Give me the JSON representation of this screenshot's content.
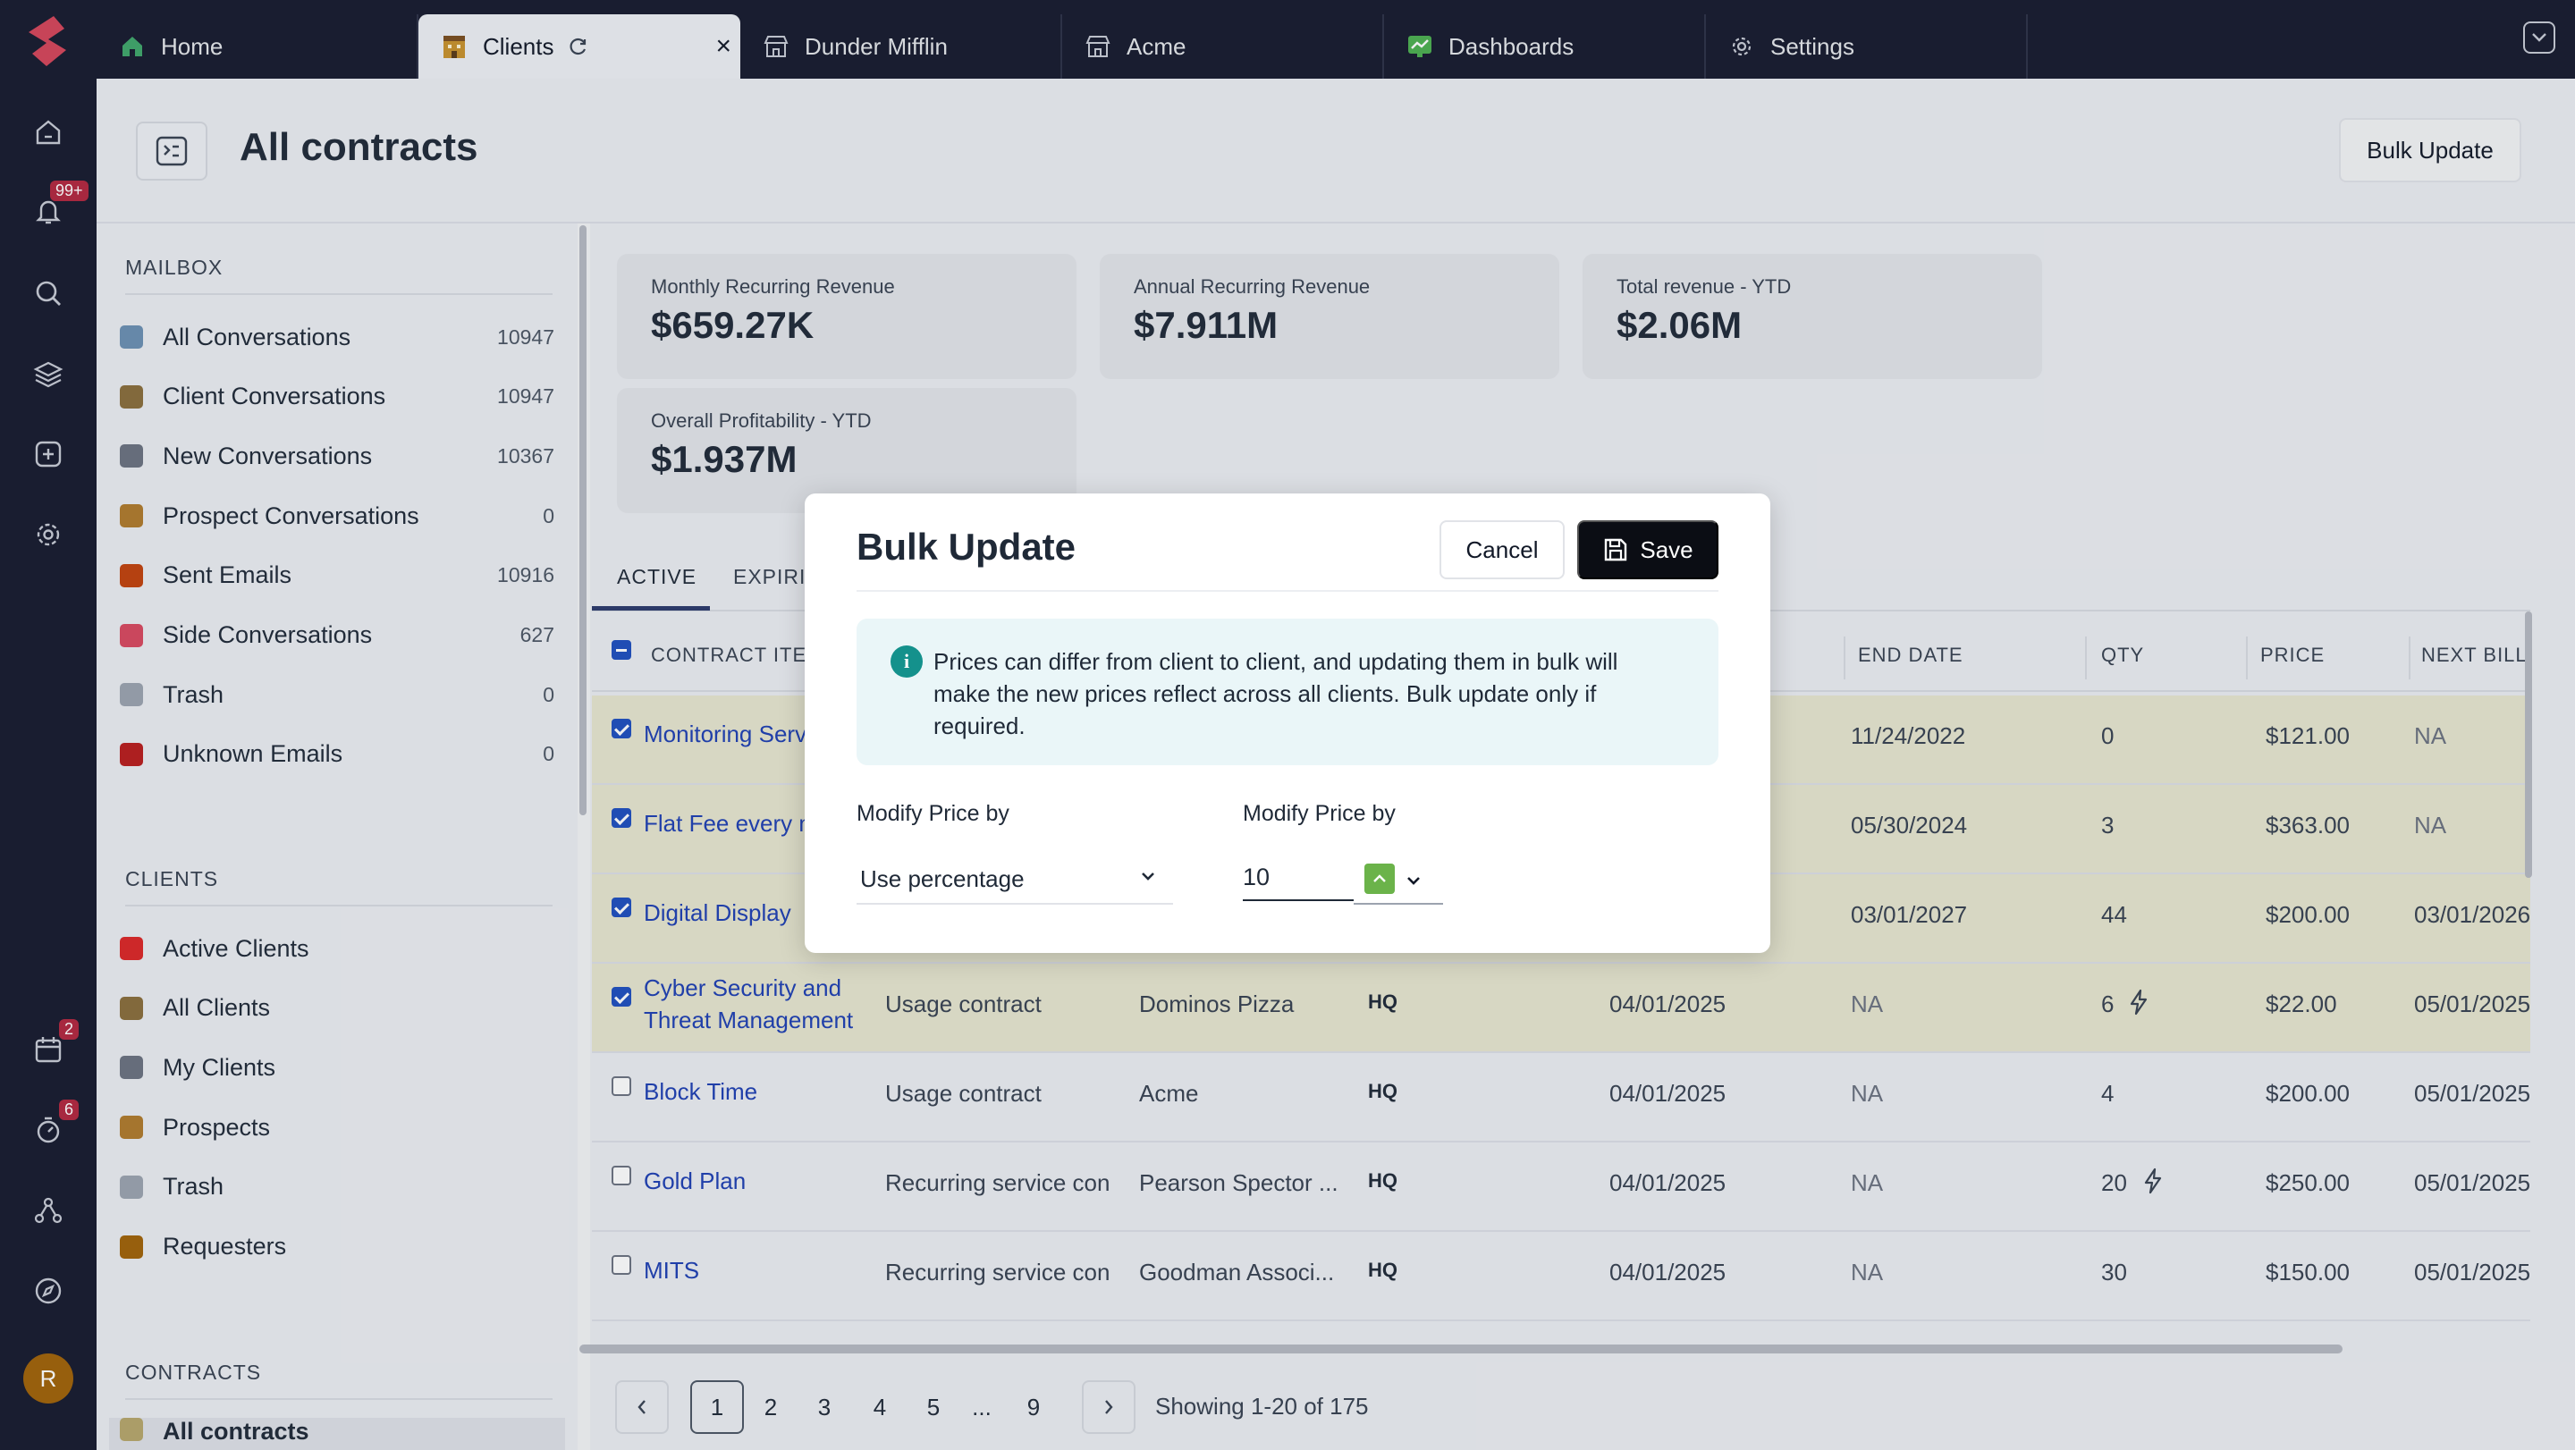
{
  "tabs": [
    {
      "label": "Home"
    },
    {
      "label": "Clients"
    },
    {
      "label": "Dunder Mifflin"
    },
    {
      "label": "Acme"
    },
    {
      "label": "Dashboards"
    },
    {
      "label": "Settings"
    }
  ],
  "rail": {
    "notifications_badge": "99+",
    "calendar_badge": "2",
    "timer_badge": "6",
    "avatar_initial": "R"
  },
  "page": {
    "title": "All contracts",
    "bulk_update_label": "Bulk Update"
  },
  "sidebar": {
    "mailbox_title": "MAILBOX",
    "mailbox": [
      {
        "label": "All Conversations",
        "count": "10947",
        "color": "#6b8fb3"
      },
      {
        "label": "Client Conversations",
        "count": "10947",
        "color": "#8a6d3b"
      },
      {
        "label": "New Conversations",
        "count": "10367",
        "color": "#6b7280"
      },
      {
        "label": "Prospect Conversations",
        "count": "0",
        "color": "#b07a2b"
      },
      {
        "label": "Sent Emails",
        "count": "10916",
        "color": "#c2410c"
      },
      {
        "label": "Side Conversations",
        "count": "627",
        "color": "#d9485f"
      },
      {
        "label": "Trash",
        "count": "0",
        "color": "#9ca3af"
      },
      {
        "label": "Unknown Emails",
        "count": "0",
        "color": "#b91c1c"
      }
    ],
    "clients_title": "CLIENTS",
    "clients": [
      {
        "label": "Active Clients",
        "color": "#dc2626"
      },
      {
        "label": "All Clients",
        "color": "#8a6d3b"
      },
      {
        "label": "My Clients",
        "color": "#6b7280"
      },
      {
        "label": "Prospects",
        "color": "#b07a2b"
      },
      {
        "label": "Trash",
        "color": "#9ca3af"
      },
      {
        "label": "Requesters",
        "color": "#a16207"
      }
    ],
    "contracts_title": "CONTRACTS",
    "contracts_selected": "All contracts"
  },
  "cards": [
    {
      "label": "Monthly Recurring Revenue",
      "value": "$659.27K"
    },
    {
      "label": "Annual Recurring Revenue",
      "value": "$7.911M"
    },
    {
      "label": "Total revenue - YTD",
      "value": "$2.06M"
    },
    {
      "label": "Overall Profitability - YTD",
      "value": "$1.937M"
    }
  ],
  "subtabs": {
    "active": "ACTIVE",
    "second": "EXPIRIN"
  },
  "table": {
    "headers": {
      "item": "CONTRACT ITEM",
      "end_date": "END DATE",
      "qty": "QTY",
      "price": "PRICE",
      "next_bill": "NEXT BILL"
    },
    "rows": [
      {
        "checked": true,
        "item": "Monitoring Serv",
        "item2": "",
        "type": "",
        "client": "",
        "site": "",
        "start": "",
        "end": "11/24/2022",
        "qty": "0",
        "bolt": false,
        "price": "$121.00",
        "next": "NA"
      },
      {
        "checked": true,
        "item": "Flat Fee every m",
        "item2": "",
        "type": "",
        "client": "",
        "site": "",
        "start": "",
        "end": "05/30/2024",
        "qty": "3",
        "bolt": false,
        "price": "$363.00",
        "next": "NA"
      },
      {
        "checked": true,
        "item": "Digital Display",
        "item2": "",
        "type": "",
        "client": "",
        "site": "",
        "start": "",
        "end": "03/01/2027",
        "qty": "44",
        "bolt": false,
        "price": "$200.00",
        "next": "03/01/2026"
      },
      {
        "checked": true,
        "item": "Cyber Security and",
        "item2": "Threat Management",
        "type": "Usage contract",
        "client": "Dominos Pizza",
        "site": "HQ",
        "start": "04/01/2025",
        "end": "NA",
        "qty": "6",
        "bolt": true,
        "price": "$22.00",
        "next": "05/01/2025"
      },
      {
        "checked": false,
        "item": "Block Time",
        "item2": "",
        "type": "Usage contract",
        "client": "Acme",
        "site": "HQ",
        "start": "04/01/2025",
        "end": "NA",
        "qty": "4",
        "bolt": false,
        "price": "$200.00",
        "next": "05/01/2025"
      },
      {
        "checked": false,
        "item": "Gold Plan",
        "item2": "",
        "type": "Recurring service con",
        "client": "Pearson Spector ...",
        "site": "HQ",
        "start": "04/01/2025",
        "end": "NA",
        "qty": "20",
        "bolt": true,
        "price": "$250.00",
        "next": "05/01/2025"
      },
      {
        "checked": false,
        "item": "MITS",
        "item2": "",
        "type": "Recurring service con",
        "client": "Goodman Associ...",
        "site": "HQ",
        "start": "04/01/2025",
        "end": "NA",
        "qty": "30",
        "bolt": false,
        "price": "$150.00",
        "next": "05/01/2025"
      }
    ]
  },
  "pagination": {
    "pages": [
      "1",
      "2",
      "3",
      "4",
      "5",
      "...",
      "9"
    ],
    "current": "1",
    "showing": "Showing 1-20 of 175"
  },
  "modal": {
    "title": "Bulk Update",
    "cancel_label": "Cancel",
    "save_label": "Save",
    "info_text": "Prices can differ from client to client, and updating them in bulk will make the new prices reflect across all clients. Bulk update only if required.",
    "modify_label_1": "Modify Price by",
    "modify_label_2": "Modify Price by",
    "select_value": "Use percentage",
    "number_value": "10"
  }
}
